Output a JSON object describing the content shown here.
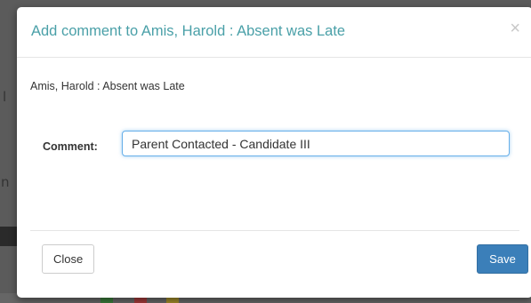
{
  "modal": {
    "title": "Add comment to Amis, Harold : Absent was Late",
    "close_icon": "×",
    "subtitle": "Amis, Harold : Absent was Late",
    "comment_label": "Comment:",
    "comment_value": "Parent Contacted - Candidate III",
    "close_button": "Close",
    "save_button": "Save"
  },
  "colors": {
    "title": "#4aa0a8",
    "save_button": "#3b7fb9",
    "input_focus_border": "#66afe9",
    "backdrop": "#5b5b5b"
  }
}
